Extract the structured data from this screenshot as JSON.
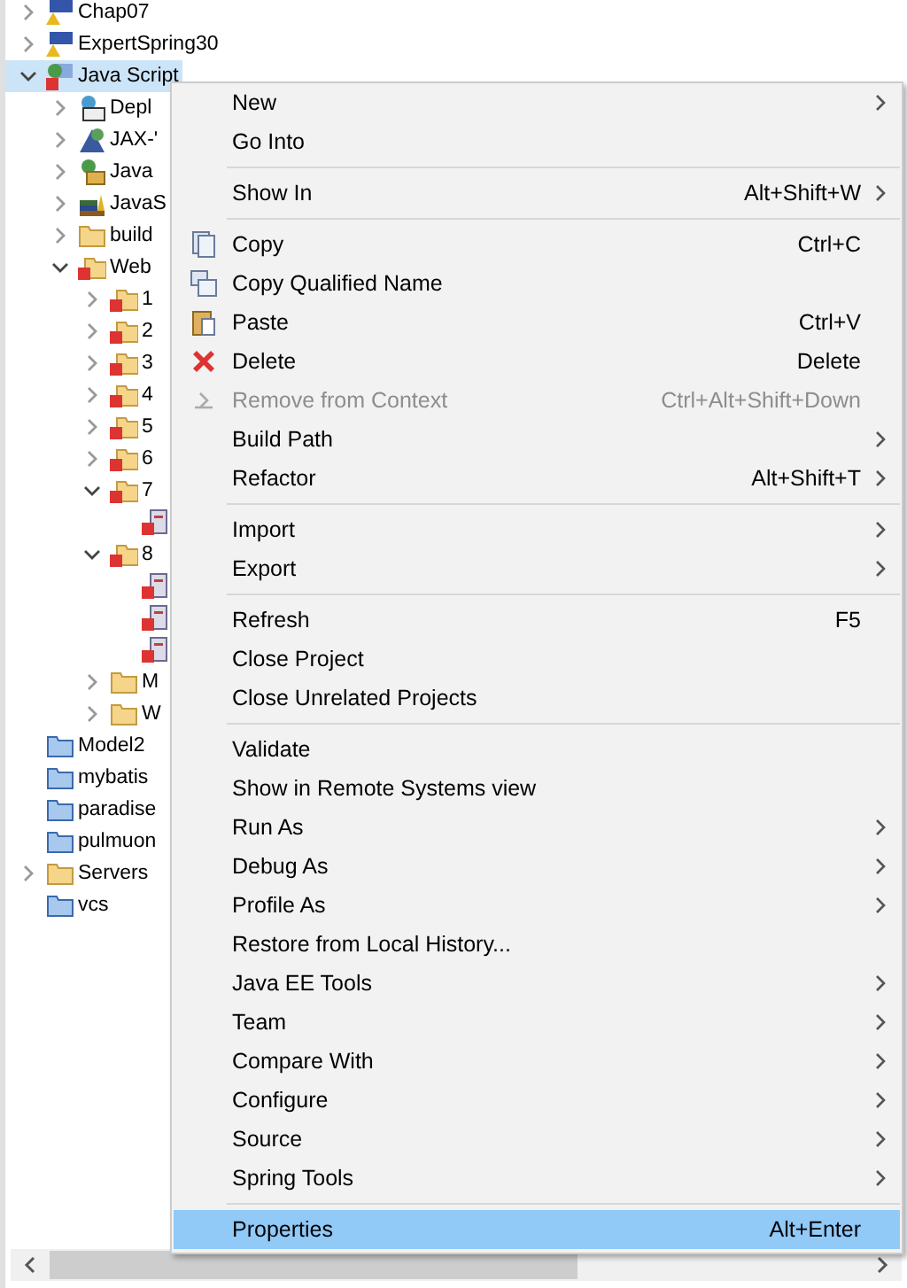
{
  "tree": [
    {
      "label": "Chap07",
      "kind": "project-warning",
      "expanded": false,
      "selected": false
    },
    {
      "label": "ExpertSpring30",
      "kind": "project-warning",
      "expanded": false,
      "selected": false
    },
    {
      "label": "Java Script",
      "kind": "project-error",
      "expanded": true,
      "selected": true,
      "children": [
        {
          "label": "Depl",
          "kind": "deploy",
          "expanded": false,
          "selected": false
        },
        {
          "label": "JAX-'",
          "kind": "jaxws",
          "expanded": false,
          "selected": false
        },
        {
          "label": "Java",
          "kind": "java-resources",
          "expanded": false,
          "selected": false
        },
        {
          "label": "JavaS",
          "kind": "library",
          "expanded": false,
          "selected": false
        },
        {
          "label": "build",
          "kind": "folder",
          "expanded": false,
          "selected": false
        },
        {
          "label": "Web",
          "kind": "folder-error",
          "expanded": true,
          "selected": false,
          "children": [
            {
              "label": "1",
              "kind": "folder-error",
              "expanded": false,
              "selected": false
            },
            {
              "label": "2",
              "kind": "folder-error",
              "expanded": false,
              "selected": false
            },
            {
              "label": "3",
              "kind": "folder-error",
              "expanded": false,
              "selected": false
            },
            {
              "label": "4",
              "kind": "folder-error",
              "expanded": false,
              "selected": false
            },
            {
              "label": "5",
              "kind": "folder-error",
              "expanded": false,
              "selected": false
            },
            {
              "label": "6",
              "kind": "folder-error",
              "expanded": false,
              "selected": false
            },
            {
              "label": "7",
              "kind": "folder-error",
              "expanded": true,
              "selected": false,
              "children": [
                {
                  "kind": "file-error",
                  "selected": false
                }
              ]
            },
            {
              "label": "8",
              "kind": "folder-error",
              "expanded": true,
              "selected": false,
              "children": [
                {
                  "kind": "file-error",
                  "selected": false
                },
                {
                  "kind": "file-error",
                  "selected": false
                },
                {
                  "kind": "file-error",
                  "selected": false
                }
              ]
            },
            {
              "label": "M",
              "kind": "folder",
              "expanded": false,
              "selected": false
            },
            {
              "label": "W",
              "kind": "folder",
              "expanded": false,
              "selected": false
            }
          ]
        }
      ]
    },
    {
      "label": "Model2",
      "kind": "closed-project",
      "selected": false
    },
    {
      "label": "mybatis",
      "kind": "closed-project",
      "selected": false
    },
    {
      "label": "paradise",
      "kind": "closed-project",
      "selected": false
    },
    {
      "label": "pulmuon",
      "kind": "closed-project",
      "selected": false
    },
    {
      "label": "Servers",
      "kind": "folder-open",
      "expanded": false,
      "selected": false
    },
    {
      "label": "vcs",
      "kind": "closed-project",
      "selected": false
    }
  ],
  "menu": [
    {
      "kind": "item",
      "label": "New",
      "submenu": true,
      "disabled": false,
      "selected": false
    },
    {
      "kind": "item",
      "label": "Go Into",
      "submenu": false,
      "disabled": false,
      "selected": false
    },
    {
      "kind": "separator"
    },
    {
      "kind": "item",
      "label": "Show In",
      "shortcut": "Alt+Shift+W",
      "submenu": true,
      "disabled": false,
      "selected": false
    },
    {
      "kind": "separator"
    },
    {
      "kind": "copy",
      "label": "Copy",
      "shortcut": "Ctrl+C",
      "submenu": false,
      "disabled": false,
      "selected": false
    },
    {
      "kind": "copy-name",
      "label": "Copy Qualified Name",
      "submenu": false,
      "disabled": false,
      "selected": false
    },
    {
      "kind": "paste",
      "label": "Paste",
      "shortcut": "Ctrl+V",
      "submenu": false,
      "disabled": false,
      "selected": false
    },
    {
      "kind": "delete",
      "label": "Delete",
      "shortcut": "Delete",
      "submenu": false,
      "disabled": false,
      "selected": false
    },
    {
      "kind": "remove",
      "label": "Remove from Context",
      "shortcut": "Ctrl+Alt+Shift+Down",
      "submenu": false,
      "disabled": true,
      "selected": false
    },
    {
      "kind": "item",
      "label": "Build Path",
      "submenu": true,
      "disabled": false,
      "selected": false
    },
    {
      "kind": "item",
      "label": "Refactor",
      "shortcut": "Alt+Shift+T",
      "submenu": true,
      "disabled": false,
      "selected": false
    },
    {
      "kind": "separator"
    },
    {
      "kind": "item",
      "label": "Import",
      "submenu": true,
      "disabled": false,
      "selected": false
    },
    {
      "kind": "item",
      "label": "Export",
      "submenu": true,
      "disabled": false,
      "selected": false
    },
    {
      "kind": "separator"
    },
    {
      "kind": "item",
      "label": "Refresh",
      "shortcut": "F5",
      "submenu": false,
      "disabled": false,
      "selected": false
    },
    {
      "kind": "item",
      "label": "Close Project",
      "submenu": false,
      "disabled": false,
      "selected": false
    },
    {
      "kind": "item",
      "label": "Close Unrelated Projects",
      "submenu": false,
      "disabled": false,
      "selected": false
    },
    {
      "kind": "separator"
    },
    {
      "kind": "item",
      "label": "Validate",
      "submenu": false,
      "disabled": false,
      "selected": false
    },
    {
      "kind": "item",
      "label": "Show in Remote Systems view",
      "submenu": false,
      "disabled": false,
      "selected": false
    },
    {
      "kind": "item",
      "label": "Run As",
      "submenu": true,
      "disabled": false,
      "selected": false
    },
    {
      "kind": "item",
      "label": "Debug As",
      "submenu": true,
      "disabled": false,
      "selected": false
    },
    {
      "kind": "item",
      "label": "Profile As",
      "submenu": true,
      "disabled": false,
      "selected": false
    },
    {
      "kind": "item",
      "label": "Restore from Local History...",
      "submenu": false,
      "disabled": false,
      "selected": false
    },
    {
      "kind": "item",
      "label": "Java EE Tools",
      "submenu": true,
      "disabled": false,
      "selected": false
    },
    {
      "kind": "item",
      "label": "Team",
      "submenu": true,
      "disabled": false,
      "selected": false
    },
    {
      "kind": "item",
      "label": "Compare With",
      "submenu": true,
      "disabled": false,
      "selected": false
    },
    {
      "kind": "item",
      "label": "Configure",
      "submenu": true,
      "disabled": false,
      "selected": false
    },
    {
      "kind": "item",
      "label": "Source",
      "submenu": true,
      "disabled": false,
      "selected": false
    },
    {
      "kind": "item",
      "label": "Spring Tools",
      "submenu": true,
      "disabled": false,
      "selected": false
    },
    {
      "kind": "separator"
    },
    {
      "kind": "item",
      "label": "Properties",
      "shortcut": "Alt+Enter",
      "submenu": false,
      "disabled": false,
      "selected": true
    }
  ]
}
